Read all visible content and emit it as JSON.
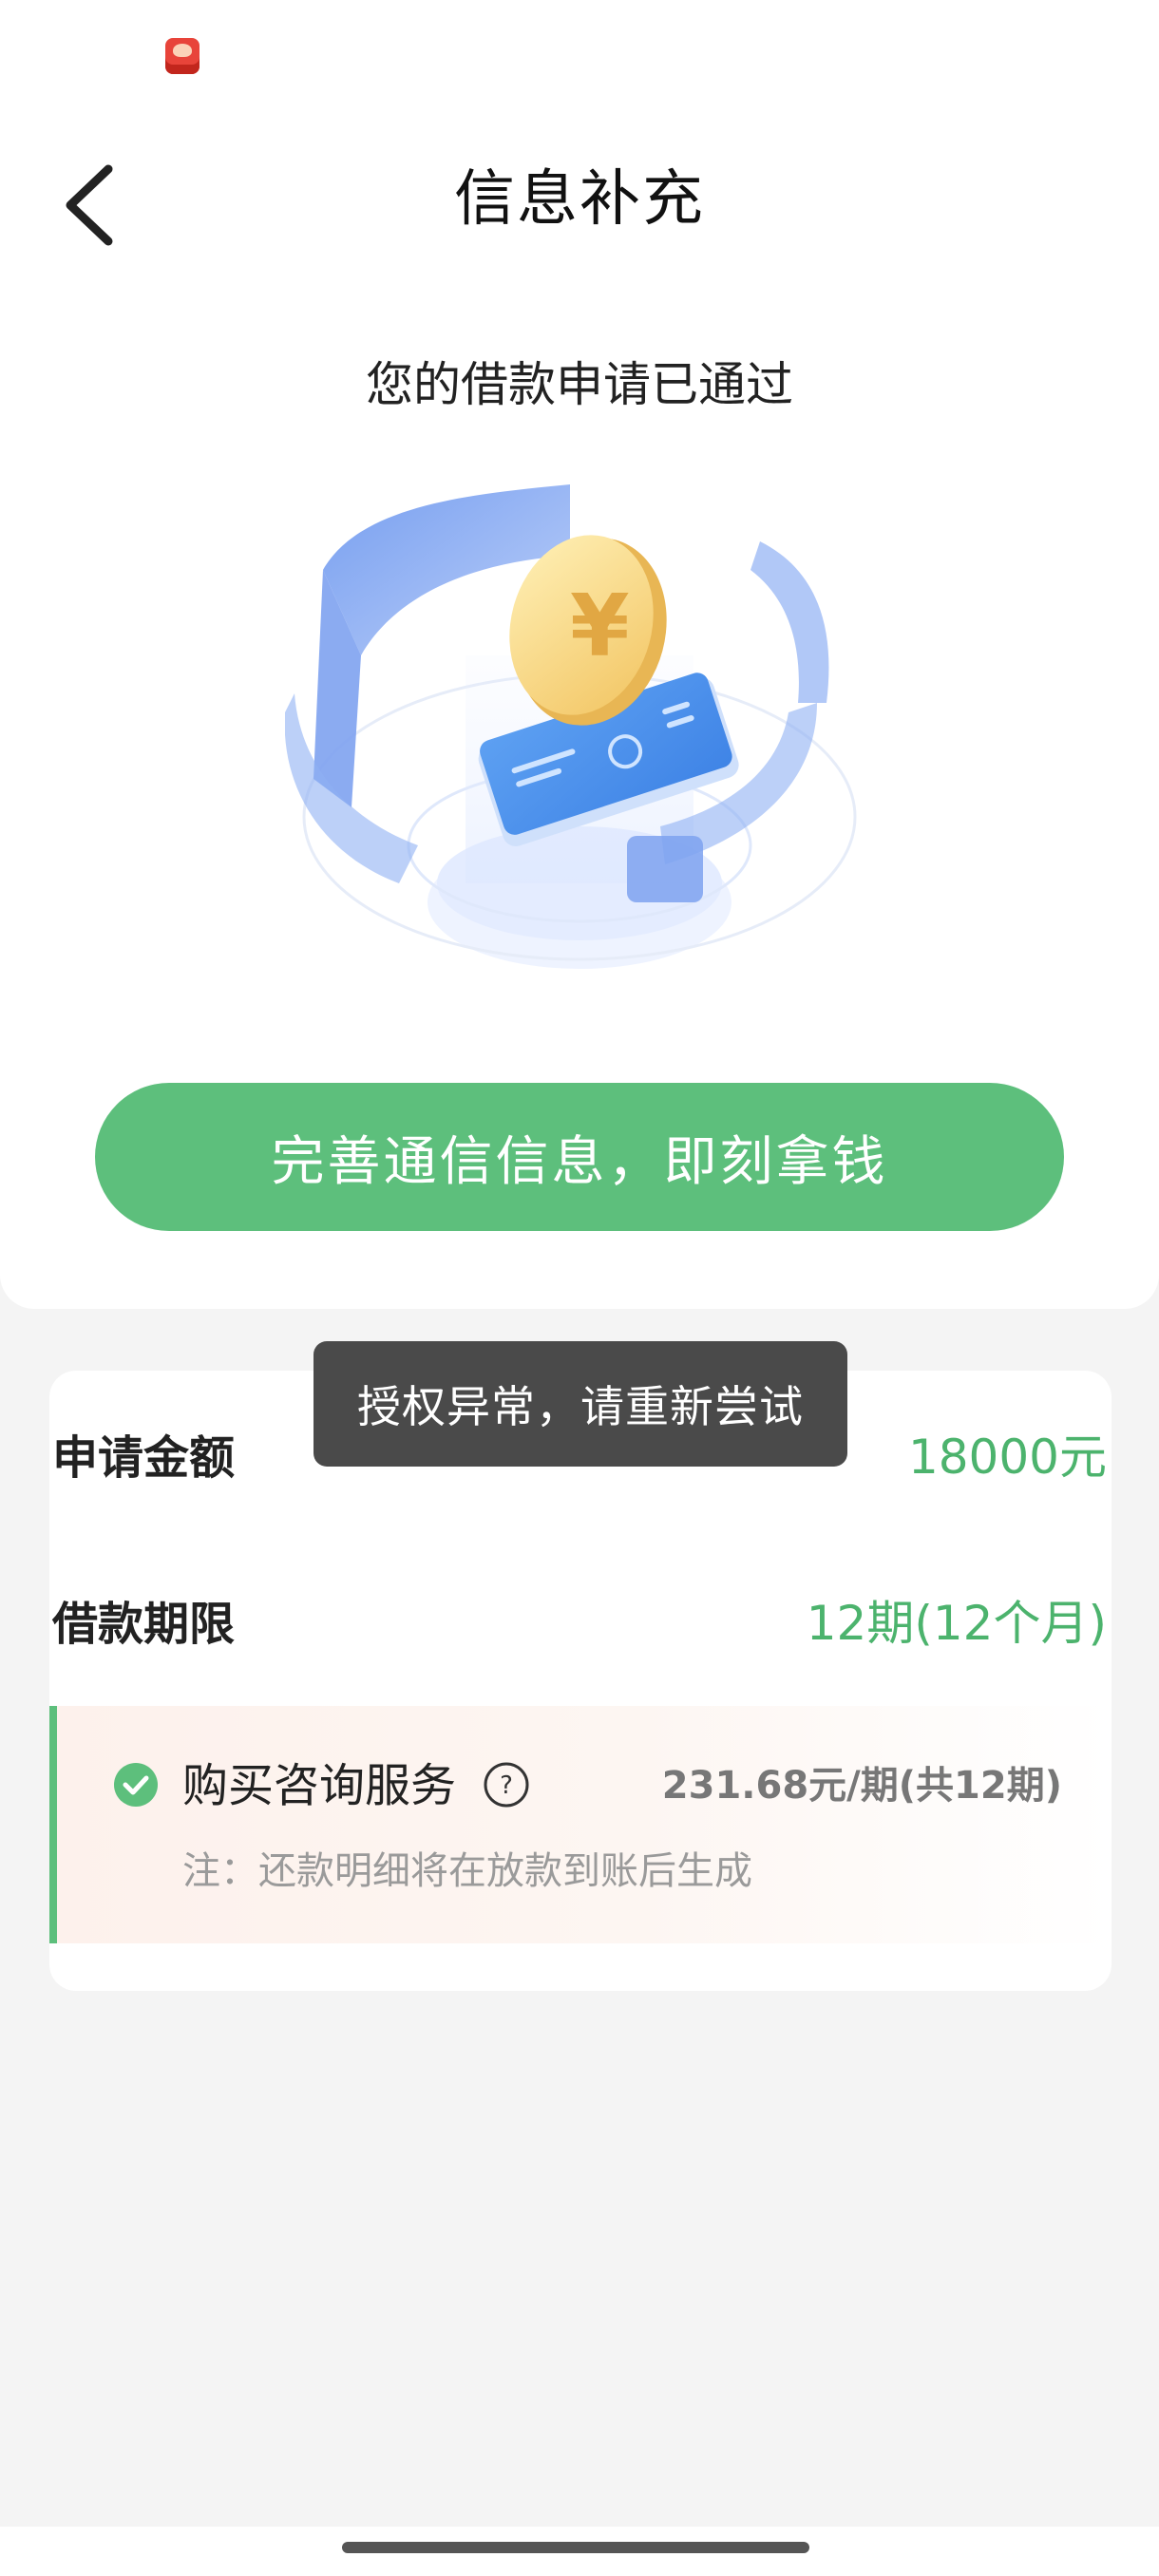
{
  "status_bar": {
    "notification_icon": "app-notification-icon"
  },
  "header": {
    "title": "信息补充",
    "back_icon": "chevron-left-icon"
  },
  "top_card": {
    "approved_text": "您的借款申请已通过",
    "illustration": "coin-phone-illustration",
    "primary_button_label": "完善通信信息，即刻拿钱"
  },
  "toast": {
    "message": "授权异常，请重新尝试"
  },
  "details": {
    "amount_label": "申请金额",
    "amount_value": "18000元",
    "term_label": "借款期限",
    "term_value": "12期(12个月)",
    "service": {
      "label": "购买咨询服务",
      "price": "231.68元/期(共12期)",
      "note": "注：还款明细将在放款到账后生成",
      "checked": true,
      "check_icon": "check-circle-icon",
      "help_icon": "question-circle-icon"
    }
  },
  "colors": {
    "accent_green": "#5dbf7c",
    "value_green": "#4cb36d",
    "toast_bg": "#4a4a4a",
    "background": "#f4f4f4"
  }
}
